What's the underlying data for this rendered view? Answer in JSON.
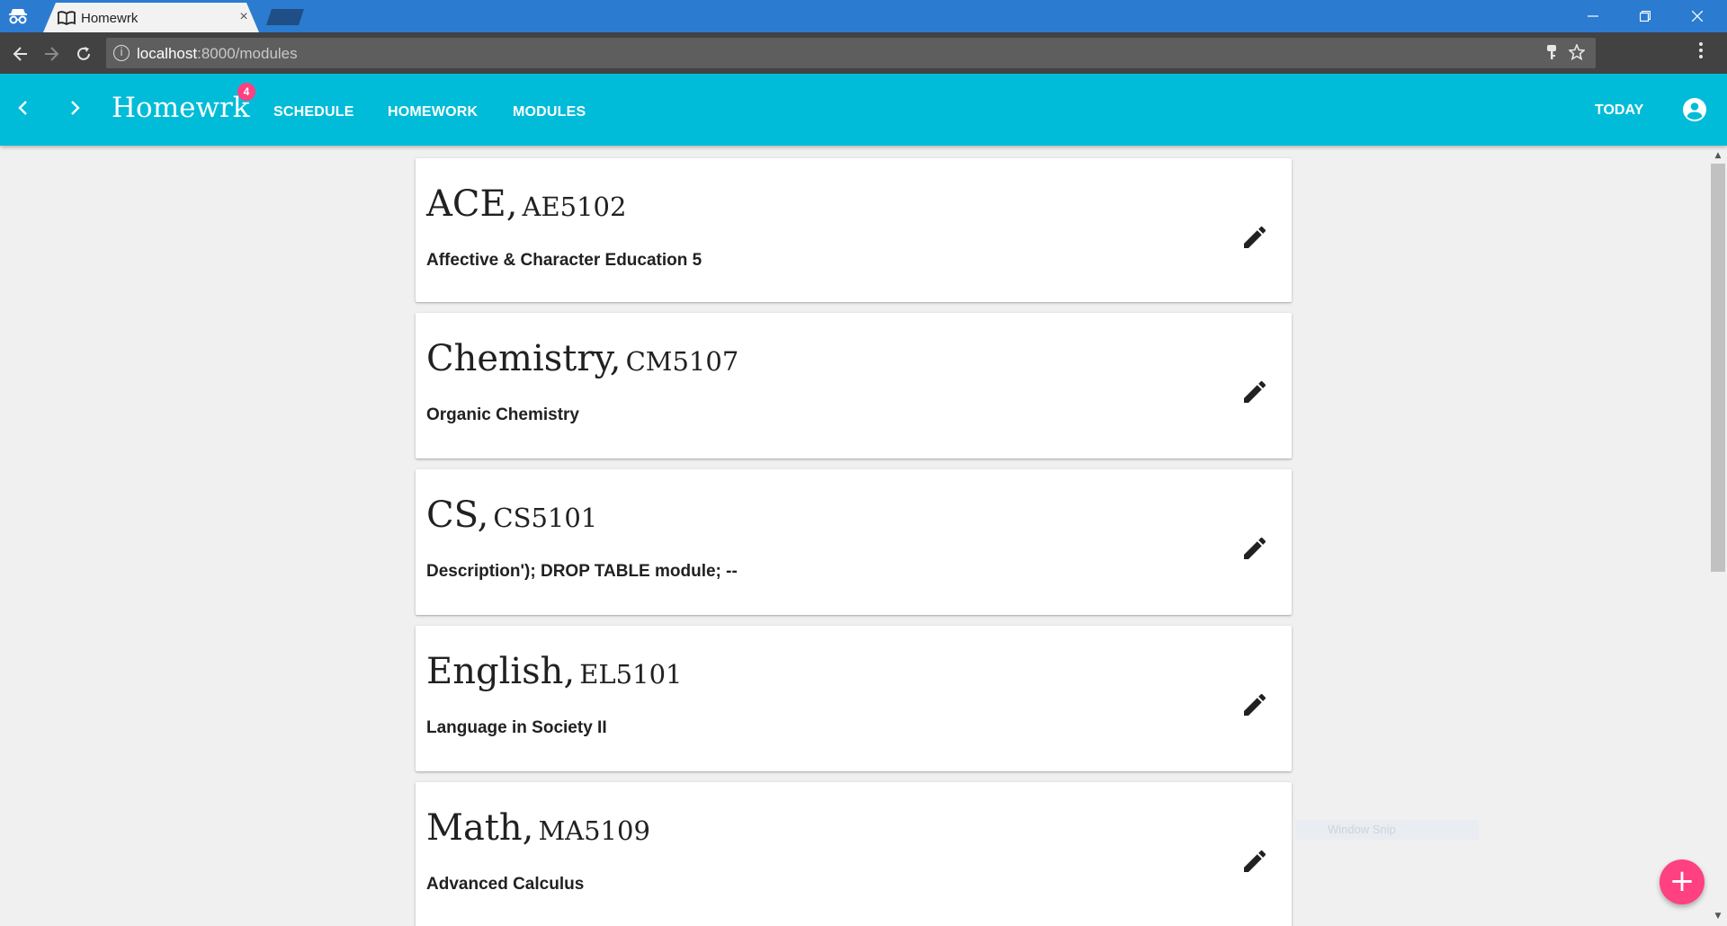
{
  "browser": {
    "tab_title": "Homewrk",
    "tab_close": "×",
    "url_host": "localhost",
    "url_path": ":8000/modules",
    "window_controls": [
      "minimize-icon",
      "restore-icon",
      "close-icon"
    ]
  },
  "appbar": {
    "brand": "Homewrk",
    "badge_count": "4",
    "nav": [
      "SCHEDULE",
      "HOMEWORK",
      "MODULES"
    ],
    "today_label": "TODAY",
    "accent_color": "#00bcd8",
    "badge_color": "#ff4081"
  },
  "modules": [
    {
      "name": "ACE,",
      "code": "AE5102",
      "description": "Affective & Character Education 5"
    },
    {
      "name": "Chemistry,",
      "code": "CM5107",
      "description": "Organic Chemistry"
    },
    {
      "name": "CS,",
      "code": "CS5101",
      "description": "Description'); DROP TABLE module; --"
    },
    {
      "name": "English,",
      "code": "EL5101",
      "description": "Language in Society II"
    },
    {
      "name": "Math,",
      "code": "MA5109",
      "description": "Advanced Calculus"
    }
  ],
  "fab": {
    "label": "+",
    "color": "#ff4081"
  },
  "overlay": {
    "label": "Window Snip"
  }
}
